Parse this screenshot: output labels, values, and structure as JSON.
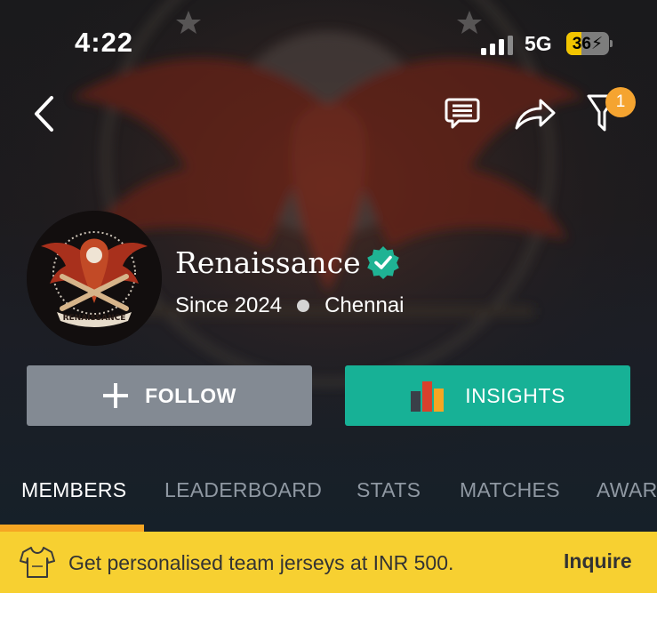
{
  "status_bar": {
    "time": "4:22",
    "network": "5G",
    "battery_level": "36",
    "battery_fraction": 0.36
  },
  "nav": {
    "icons": [
      "back-icon",
      "chat-icon",
      "share-icon",
      "filter-icon"
    ],
    "filter_badge": "1"
  },
  "team": {
    "name": "Renaissance",
    "verified": true,
    "since": "Since 2024",
    "city": "Chennai",
    "logo_text": "RENAISSANCE"
  },
  "actions": {
    "follow_label": "FOLLOW",
    "insights_label": "INSIGHTS"
  },
  "tabs": [
    "MEMBERS",
    "LEADERBOARD",
    "STATS",
    "MATCHES",
    "AWAR"
  ],
  "active_tab": 0,
  "promo": {
    "text": "Get personalised team jerseys at INR 500.",
    "link": "Inquire"
  },
  "colors": {
    "accent_green": "#17b196",
    "follow_gray": "#838a93",
    "tab_indicator": "#f5a623",
    "promo_bg": "#f7d031",
    "badge": "#f5a430"
  }
}
